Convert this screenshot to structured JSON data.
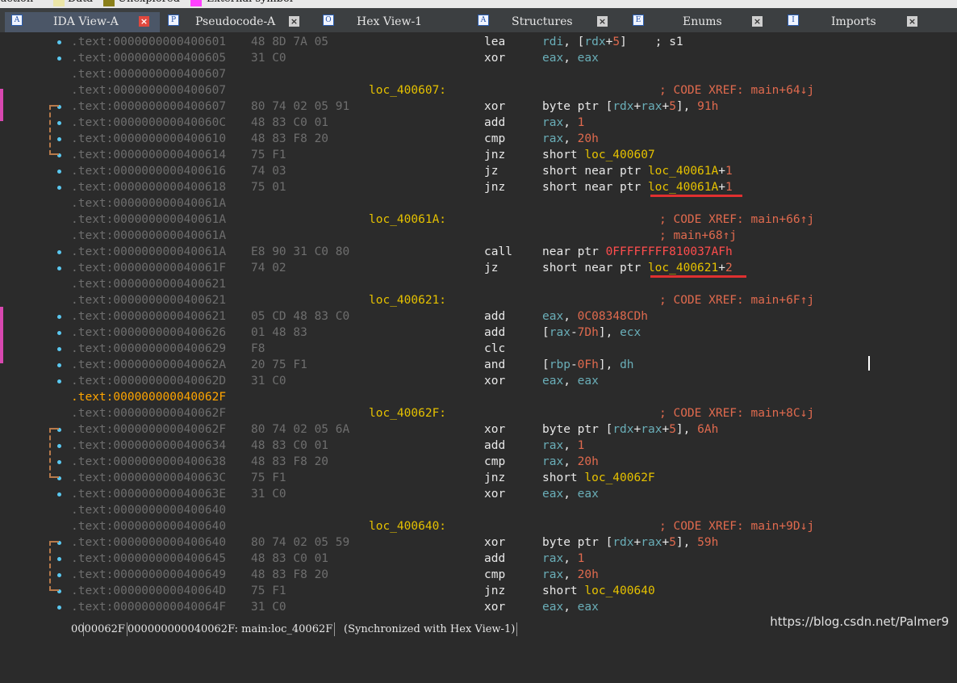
{
  "legend": [
    {
      "label": "uction",
      "color": ""
    },
    {
      "label": "Data",
      "color": "#ece6a8"
    },
    {
      "label": "Unexplored",
      "color": "#8a7f1a"
    },
    {
      "label": "External symbol",
      "color": "#ff40ff"
    }
  ],
  "tabs": [
    {
      "label": "IDA View-A",
      "icon": "ida-view-icon",
      "active": true
    },
    {
      "label": "Pseudocode-A",
      "icon": "pseudocode-icon",
      "active": false
    },
    {
      "label": "Hex View-1",
      "icon": "hex-view-icon",
      "active": false
    },
    {
      "label": "Structures",
      "icon": "structures-icon",
      "active": false
    },
    {
      "label": "Enums",
      "icon": "enums-icon",
      "active": false
    },
    {
      "label": "Imports",
      "icon": "imports-icon",
      "active": false
    }
  ],
  "tab_close_glyph": "×",
  "lines": [
    {
      "addr": ".text:0000000000400601",
      "bytes": "48 8D 7A 05",
      "label": "",
      "mn": "lea",
      "op": [
        {
          "t": "rdi",
          "k": "reg"
        },
        {
          "t": ", [",
          "k": "txt"
        },
        {
          "t": "rdx",
          "k": "reg"
        },
        {
          "t": "+",
          "k": "txt"
        },
        {
          "t": "5",
          "k": "num"
        },
        {
          "t": "]",
          "k": "txt"
        },
        {
          "t": "    ; s1",
          "k": "txt"
        }
      ],
      "comment": "",
      "dot": true
    },
    {
      "addr": ".text:0000000000400605",
      "bytes": "31 C0",
      "label": "",
      "mn": "xor",
      "op": [
        {
          "t": "eax",
          "k": "reg"
        },
        {
          "t": ", ",
          "k": "txt"
        },
        {
          "t": "eax",
          "k": "reg"
        }
      ],
      "comment": "",
      "dot": true
    },
    {
      "addr": ".text:0000000000400607",
      "bytes": "",
      "label": "",
      "mn": "",
      "op": [],
      "comment": "",
      "dot": false
    },
    {
      "addr": ".text:0000000000400607",
      "bytes": "",
      "label": "loc_400607:",
      "mn": "",
      "op": [],
      "comment": "; CODE XREF: main+64↓j",
      "dot": false
    },
    {
      "addr": ".text:0000000000400607",
      "bytes": "80 74 02 05 91",
      "label": "",
      "mn": "xor",
      "op": [
        {
          "t": "byte ptr [",
          "k": "txt"
        },
        {
          "t": "rdx",
          "k": "reg"
        },
        {
          "t": "+",
          "k": "txt"
        },
        {
          "t": "rax",
          "k": "reg"
        },
        {
          "t": "+",
          "k": "txt"
        },
        {
          "t": "5",
          "k": "num"
        },
        {
          "t": "], ",
          "k": "txt"
        },
        {
          "t": "91h",
          "k": "num"
        }
      ],
      "comment": "",
      "dot": true
    },
    {
      "addr": ".text:000000000040060C",
      "bytes": "48 83 C0 01",
      "label": "",
      "mn": "add",
      "op": [
        {
          "t": "rax",
          "k": "reg"
        },
        {
          "t": ", ",
          "k": "txt"
        },
        {
          "t": "1",
          "k": "num"
        }
      ],
      "comment": "",
      "dot": true
    },
    {
      "addr": ".text:0000000000400610",
      "bytes": "48 83 F8 20",
      "label": "",
      "mn": "cmp",
      "op": [
        {
          "t": "rax",
          "k": "reg"
        },
        {
          "t": ", ",
          "k": "txt"
        },
        {
          "t": "20h",
          "k": "num"
        }
      ],
      "comment": "",
      "dot": true
    },
    {
      "addr": ".text:0000000000400614",
      "bytes": "75 F1",
      "label": "",
      "mn": "jnz",
      "op": [
        {
          "t": "short ",
          "k": "txt"
        },
        {
          "t": "loc_400607",
          "k": "lbl"
        }
      ],
      "comment": "",
      "dot": true
    },
    {
      "addr": ".text:0000000000400616",
      "bytes": "74 03",
      "label": "",
      "mn": "jz",
      "op": [
        {
          "t": "short near ptr ",
          "k": "txt"
        },
        {
          "t": "loc_40061A",
          "k": "lbl"
        },
        {
          "t": "+",
          "k": "txt"
        },
        {
          "t": "1",
          "k": "num"
        }
      ],
      "comment": "",
      "dot": true
    },
    {
      "addr": ".text:0000000000400618",
      "bytes": "75 01",
      "label": "",
      "mn": "jnz",
      "op": [
        {
          "t": "short near ptr ",
          "k": "txt"
        },
        {
          "t": "loc_40061A",
          "k": "lbl"
        },
        {
          "t": "+",
          "k": "txt"
        },
        {
          "t": "1",
          "k": "num"
        }
      ],
      "comment": "",
      "dot": true
    },
    {
      "addr": ".text:000000000040061A",
      "bytes": "",
      "label": "",
      "mn": "",
      "op": [],
      "comment": "",
      "dot": false
    },
    {
      "addr": ".text:000000000040061A",
      "bytes": "",
      "label": "loc_40061A:",
      "mn": "",
      "op": [],
      "comment": "; CODE XREF: main+66↑j",
      "dot": false
    },
    {
      "addr": ".text:000000000040061A",
      "bytes": "",
      "label": "",
      "mn": "",
      "op": [],
      "comment": "; main+68↑j",
      "dot": false
    },
    {
      "addr": ".text:000000000040061A",
      "bytes": "E8 90 31 C0 80",
      "label": "",
      "mn": "call",
      "op": [
        {
          "t": "near ptr ",
          "k": "txt"
        },
        {
          "t": "0FFFFFFFF810037AFh",
          "k": "red"
        }
      ],
      "comment": "",
      "dot": true
    },
    {
      "addr": ".text:000000000040061F",
      "bytes": "74 02",
      "label": "",
      "mn": "jz",
      "op": [
        {
          "t": "short near ptr ",
          "k": "txt"
        },
        {
          "t": "loc_400621",
          "k": "lbl"
        },
        {
          "t": "+",
          "k": "txt"
        },
        {
          "t": "2",
          "k": "num"
        }
      ],
      "comment": "",
      "dot": true
    },
    {
      "addr": ".text:0000000000400621",
      "bytes": "",
      "label": "",
      "mn": "",
      "op": [],
      "comment": "",
      "dot": false
    },
    {
      "addr": ".text:0000000000400621",
      "bytes": "",
      "label": "loc_400621:",
      "mn": "",
      "op": [],
      "comment": "; CODE XREF: main+6F↑j",
      "dot": false
    },
    {
      "addr": ".text:0000000000400621",
      "bytes": "05 CD 48 83 C0",
      "label": "",
      "mn": "add",
      "op": [
        {
          "t": "eax",
          "k": "reg"
        },
        {
          "t": ", ",
          "k": "txt"
        },
        {
          "t": "0C08348CDh",
          "k": "num"
        }
      ],
      "comment": "",
      "dot": true
    },
    {
      "addr": ".text:0000000000400626",
      "bytes": "01 48 83",
      "label": "",
      "mn": "add",
      "op": [
        {
          "t": "[",
          "k": "txt"
        },
        {
          "t": "rax",
          "k": "reg"
        },
        {
          "t": "-",
          "k": "txt"
        },
        {
          "t": "7Dh",
          "k": "num"
        },
        {
          "t": "], ",
          "k": "txt"
        },
        {
          "t": "ecx",
          "k": "reg"
        }
      ],
      "comment": "",
      "dot": true
    },
    {
      "addr": ".text:0000000000400629",
      "bytes": "F8",
      "label": "",
      "mn": "clc",
      "op": [],
      "comment": "",
      "dot": true
    },
    {
      "addr": ".text:000000000040062A",
      "bytes": "20 75 F1",
      "label": "",
      "mn": "and",
      "op": [
        {
          "t": "[",
          "k": "txt"
        },
        {
          "t": "rbp",
          "k": "reg"
        },
        {
          "t": "-",
          "k": "txt"
        },
        {
          "t": "0Fh",
          "k": "num"
        },
        {
          "t": "], ",
          "k": "txt"
        },
        {
          "t": "dh",
          "k": "reg"
        }
      ],
      "comment": "",
      "dot": true
    },
    {
      "addr": ".text:000000000040062D",
      "bytes": "31 C0",
      "label": "",
      "mn": "xor",
      "op": [
        {
          "t": "eax",
          "k": "reg"
        },
        {
          "t": ", ",
          "k": "txt"
        },
        {
          "t": "eax",
          "k": "reg"
        }
      ],
      "comment": "",
      "dot": true
    },
    {
      "addr": ".text:000000000040062F",
      "bytes": "",
      "label": "",
      "mn": "",
      "op": [],
      "comment": "",
      "dot": false,
      "highlight": true
    },
    {
      "addr": ".text:000000000040062F",
      "bytes": "",
      "label": "loc_40062F:",
      "mn": "",
      "op": [],
      "comment": "; CODE XREF: main+8C↓j",
      "dot": false
    },
    {
      "addr": ".text:000000000040062F",
      "bytes": "80 74 02 05 6A",
      "label": "",
      "mn": "xor",
      "op": [
        {
          "t": "byte ptr [",
          "k": "txt"
        },
        {
          "t": "rdx",
          "k": "reg"
        },
        {
          "t": "+",
          "k": "txt"
        },
        {
          "t": "rax",
          "k": "reg"
        },
        {
          "t": "+",
          "k": "txt"
        },
        {
          "t": "5",
          "k": "num"
        },
        {
          "t": "], ",
          "k": "txt"
        },
        {
          "t": "6Ah",
          "k": "num"
        }
      ],
      "comment": "",
      "dot": true
    },
    {
      "addr": ".text:0000000000400634",
      "bytes": "48 83 C0 01",
      "label": "",
      "mn": "add",
      "op": [
        {
          "t": "rax",
          "k": "reg"
        },
        {
          "t": ", ",
          "k": "txt"
        },
        {
          "t": "1",
          "k": "num"
        }
      ],
      "comment": "",
      "dot": true
    },
    {
      "addr": ".text:0000000000400638",
      "bytes": "48 83 F8 20",
      "label": "",
      "mn": "cmp",
      "op": [
        {
          "t": "rax",
          "k": "reg"
        },
        {
          "t": ", ",
          "k": "txt"
        },
        {
          "t": "20h",
          "k": "num"
        }
      ],
      "comment": "",
      "dot": true
    },
    {
      "addr": ".text:000000000040063C",
      "bytes": "75 F1",
      "label": "",
      "mn": "jnz",
      "op": [
        {
          "t": "short ",
          "k": "txt"
        },
        {
          "t": "loc_40062F",
          "k": "lbl"
        }
      ],
      "comment": "",
      "dot": true
    },
    {
      "addr": ".text:000000000040063E",
      "bytes": "31 C0",
      "label": "",
      "mn": "xor",
      "op": [
        {
          "t": "eax",
          "k": "reg"
        },
        {
          "t": ", ",
          "k": "txt"
        },
        {
          "t": "eax",
          "k": "reg"
        }
      ],
      "comment": "",
      "dot": true
    },
    {
      "addr": ".text:0000000000400640",
      "bytes": "",
      "label": "",
      "mn": "",
      "op": [],
      "comment": "",
      "dot": false
    },
    {
      "addr": ".text:0000000000400640",
      "bytes": "",
      "label": "loc_400640:",
      "mn": "",
      "op": [],
      "comment": "; CODE XREF: main+9D↓j",
      "dot": false
    },
    {
      "addr": ".text:0000000000400640",
      "bytes": "80 74 02 05 59",
      "label": "",
      "mn": "xor",
      "op": [
        {
          "t": "byte ptr [",
          "k": "txt"
        },
        {
          "t": "rdx",
          "k": "reg"
        },
        {
          "t": "+",
          "k": "txt"
        },
        {
          "t": "rax",
          "k": "reg"
        },
        {
          "t": "+",
          "k": "txt"
        },
        {
          "t": "5",
          "k": "num"
        },
        {
          "t": "], ",
          "k": "txt"
        },
        {
          "t": "59h",
          "k": "num"
        }
      ],
      "comment": "",
      "dot": true
    },
    {
      "addr": ".text:0000000000400645",
      "bytes": "48 83 C0 01",
      "label": "",
      "mn": "add",
      "op": [
        {
          "t": "rax",
          "k": "reg"
        },
        {
          "t": ", ",
          "k": "txt"
        },
        {
          "t": "1",
          "k": "num"
        }
      ],
      "comment": "",
      "dot": true
    },
    {
      "addr": ".text:0000000000400649",
      "bytes": "48 83 F8 20",
      "label": "",
      "mn": "cmp",
      "op": [
        {
          "t": "rax",
          "k": "reg"
        },
        {
          "t": ", ",
          "k": "txt"
        },
        {
          "t": "20h",
          "k": "num"
        }
      ],
      "comment": "",
      "dot": true
    },
    {
      "addr": ".text:000000000040064D",
      "bytes": "75 F1",
      "label": "",
      "mn": "jnz",
      "op": [
        {
          "t": "short ",
          "k": "txt"
        },
        {
          "t": "loc_400640",
          "k": "lbl"
        }
      ],
      "comment": "",
      "dot": true
    },
    {
      "addr": ".text:000000000040064F",
      "bytes": "31 C0",
      "label": "",
      "mn": "xor",
      "op": [
        {
          "t": "eax",
          "k": "reg"
        },
        {
          "t": ", ",
          "k": "txt"
        },
        {
          "t": "eax",
          "k": "reg"
        }
      ],
      "comment": "",
      "dot": true
    }
  ],
  "status": {
    "offset": "0000062F",
    "location": "000000000040062F: main:loc_40062F",
    "sync": "(Synchronized with Hex View-1)"
  },
  "watermark": "https://blog.csdn.net/Palmer9",
  "colors": {
    "background": "#2b2b2b",
    "address": "#6e6e6e",
    "label": "#e5c100",
    "comment": "#e06a4e",
    "register": "#6aaeb8",
    "number": "#e06a4e",
    "highlighted_address": "#ffa500",
    "annotation_underline": "#e03030"
  }
}
